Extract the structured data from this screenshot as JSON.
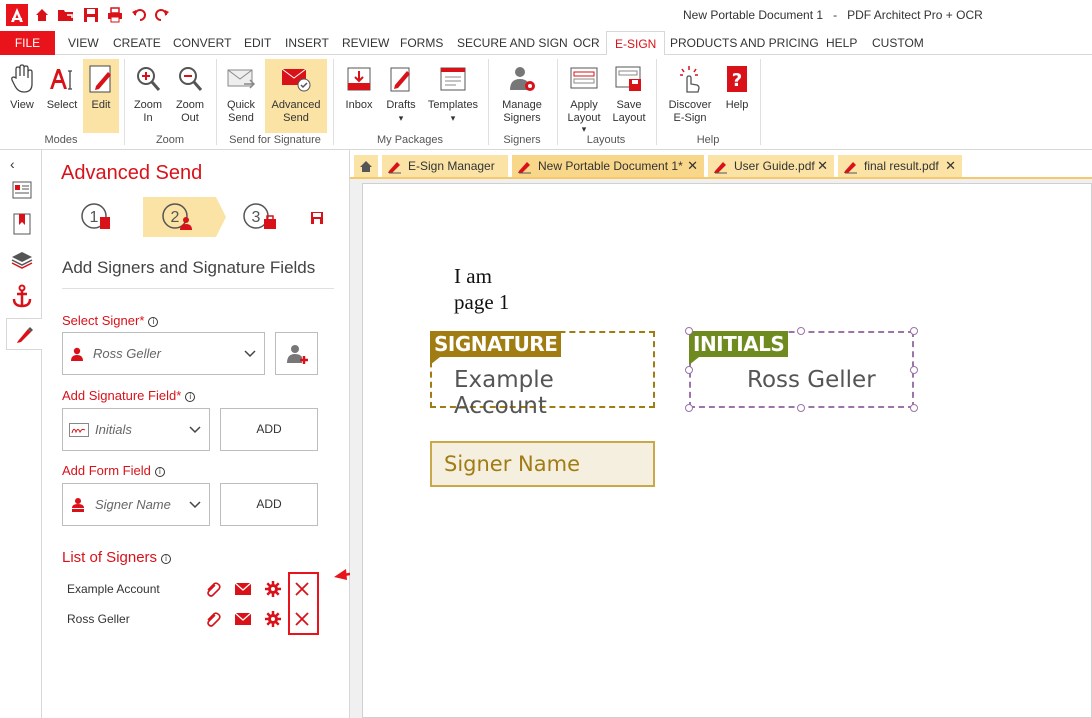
{
  "app": {
    "title": "New Portable Document 1   -   PDF Architect Pro + OCR"
  },
  "menu": {
    "file": "FILE",
    "items": [
      "VIEW",
      "CREATE",
      "CONVERT",
      "EDIT",
      "INSERT",
      "REVIEW",
      "FORMS",
      "SECURE AND SIGN",
      "OCR",
      "E-SIGN",
      "PRODUCTS AND PRICING",
      "HELP",
      "CUSTOM"
    ],
    "active": "E-SIGN"
  },
  "ribbon": {
    "view": "View",
    "select": "Select",
    "edit": "Edit",
    "zoom_in_1": "Zoom",
    "zoom_in_2": "In",
    "zoom_out_1": "Zoom",
    "zoom_out_2": "Out",
    "quick_send_1": "Quick",
    "quick_send_2": "Send",
    "adv_send_1": "Advanced",
    "adv_send_2": "Send",
    "inbox": "Inbox",
    "drafts": "Drafts",
    "templates": "Templates",
    "manage_1": "Manage",
    "manage_2": "Signers",
    "apply_1": "Apply",
    "apply_2": "Layout",
    "save_1": "Save",
    "save_2": "Layout",
    "discover_1": "Discover",
    "discover_2": "E-Sign",
    "help": "Help",
    "groups": {
      "modes": "Modes",
      "zoom": "Zoom",
      "send": "Send for Signature",
      "packages": "My Packages",
      "signers": "Signers",
      "layouts": "Layouts",
      "help": "Help"
    }
  },
  "panel": {
    "title": "Advanced Send",
    "subtitle": "Add Signers and Signature Fields",
    "select_signer_label": "Select Signer",
    "select_signer_value": "Ross Geller",
    "add_sig_label": "Add Signature Field",
    "add_sig_value": "Initials",
    "add_form_label": "Add Form Field",
    "add_form_value": "Signer Name",
    "add_btn": "ADD",
    "list_label": "List of Signers",
    "signers": [
      "Example Account",
      "Ross Geller"
    ],
    "required_mark": "*",
    "steps": [
      "1",
      "2",
      "3"
    ]
  },
  "tabs": [
    "E-Sign Manager",
    "New Portable Document 1*",
    "User Guide.pdf",
    "final result.pdf"
  ],
  "document": {
    "line1": "I am",
    "line2": "page 1",
    "sig_tag": "SIGNATURE",
    "sig_value": "Example Account",
    "init_tag": "INITIALS",
    "init_value": "Ross Geller",
    "form_value": "Signer Name"
  },
  "colors": {
    "brand_red": "#d9121a",
    "active_yellow": "#fbe3a6",
    "signature_gold": "#a07c12",
    "initials_green": "#6f8a1f"
  }
}
